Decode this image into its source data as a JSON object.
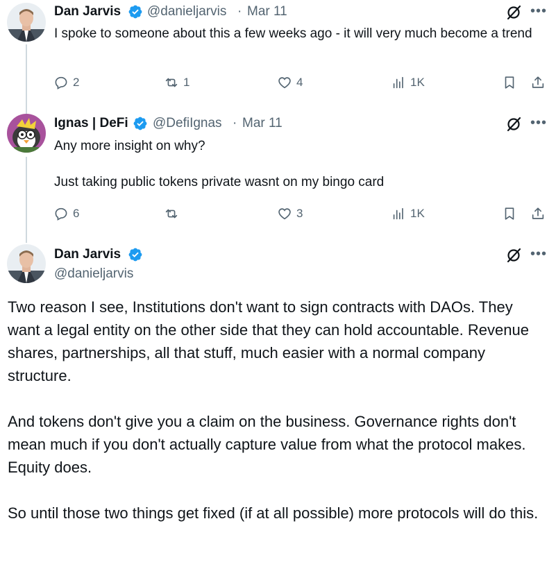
{
  "colors": {
    "text": "#0f1419",
    "secondary": "#536471",
    "verified": "#1d9bf0",
    "thread_line": "#cfd9de"
  },
  "tweets": [
    {
      "author": "Dan Jarvis",
      "handle": "@danieljarvis",
      "sep": "·",
      "date": "Mar 11",
      "text": "I spoke to someone about this a few weeks ago - it will very much become a trend",
      "replies": "2",
      "reposts": "1",
      "likes": "4",
      "views": "1K"
    },
    {
      "author": "Ignas | DeFi",
      "handle": "@DefiIgnas",
      "sep": "·",
      "date": "Mar 11",
      "text": "Any more insight on why?\n\nJust taking public tokens private wasnt on my bingo card",
      "replies": "6",
      "reposts": "",
      "likes": "3",
      "views": "1K"
    }
  ],
  "main": {
    "author": "Dan Jarvis",
    "handle": "@danieljarvis",
    "paragraphs": [
      "Two reason I see, Institutions don't want to sign contracts with DAOs. They want a legal entity on the other side that they can hold accountable. Revenue shares, partnerships, all that stuff, much easier with a normal company structure.",
      "And tokens don't give you a claim on the business. Governance rights don't mean much if you don't actually capture value from what the protocol makes. Equity does.",
      "So until those two things get fixed (if at all possible) more protocols will do this."
    ]
  },
  "icons": {
    "verified": "verified-badge-icon",
    "grok": "grok-icon",
    "more": "more-icon",
    "reply": "reply-icon",
    "repost": "repost-icon",
    "like": "like-icon",
    "views": "views-icon",
    "bookmark": "bookmark-icon",
    "share": "share-icon"
  }
}
